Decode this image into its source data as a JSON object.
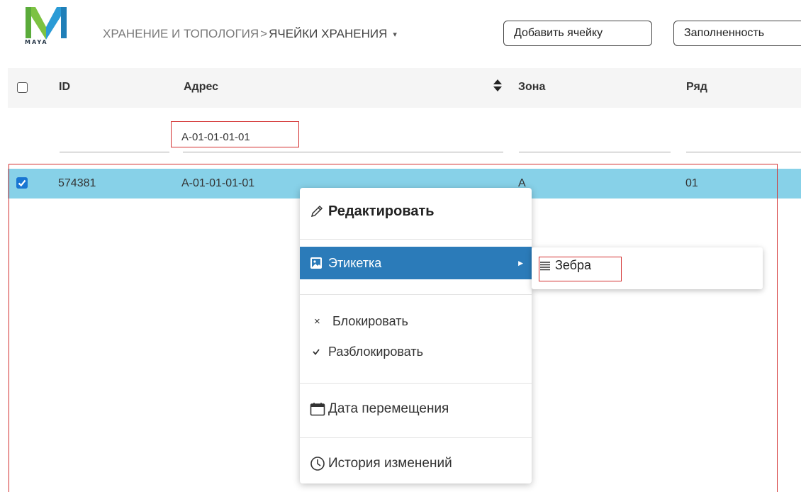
{
  "logo": {
    "text": "MAYA"
  },
  "breadcrumb": {
    "parent": "ХРАНЕНИЕ И ТОПОЛОГИЯ",
    "separator": ">",
    "current": "ЯЧЕЙКИ ХРАНЕНИЯ",
    "caret": "▾"
  },
  "toolbar": {
    "add_cell": "Добавить ячейку",
    "occupancy": "Заполненность"
  },
  "table": {
    "columns": [
      "ID",
      "Адрес",
      "Зона",
      "Ряд"
    ],
    "filters": {
      "address": "A-01-01-01-01"
    },
    "rows": [
      {
        "checked": true,
        "id": "574381",
        "address": "A-01-01-01-01",
        "zone": "A",
        "row": "01"
      }
    ]
  },
  "context_menu": {
    "edit": "Редактировать",
    "label": "Этикетка",
    "block": "Блокировать",
    "unblock": "Разблокировать",
    "move_date": "Дата перемещения",
    "history": "История изменений"
  },
  "submenu": {
    "zebra": "Зебра"
  },
  "colors": {
    "selected_row": "#87d1e8",
    "menu_highlight": "#2b7bb9",
    "annotation_red": "#d32f2f",
    "logo_green": "#7cc242",
    "logo_blue": "#2b9bd6"
  },
  "icons": {
    "edit": "pencil-icon",
    "label": "image-icon",
    "block": "x-icon",
    "unblock": "check-icon",
    "date": "calendar-icon",
    "history": "clock-icon",
    "zebra": "lines-icon",
    "sort": "sort-icon"
  }
}
